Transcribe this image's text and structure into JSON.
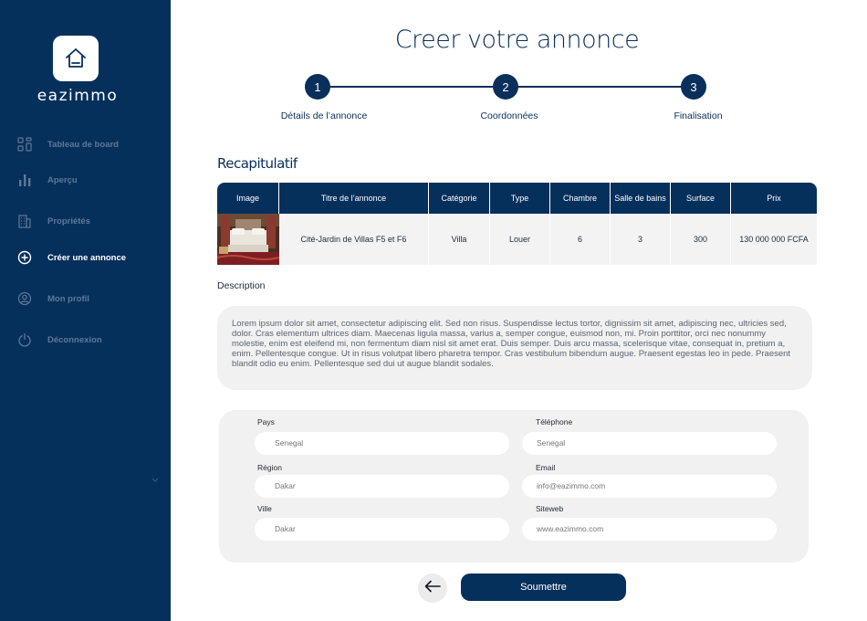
{
  "sidebar": {
    "logo_text": "eazimmo",
    "items": [
      {
        "label": "Tableau de board",
        "icon": "dashboard-icon"
      },
      {
        "label": "Aperçu",
        "icon": "bar-chart-icon"
      },
      {
        "label": "Propriétés",
        "icon": "building-icon"
      },
      {
        "label": "Créer une annonce",
        "icon": "plus-circle-icon"
      },
      {
        "label": "Mon profil",
        "icon": "user-circle-icon"
      },
      {
        "label": "Déconnexion",
        "icon": "power-icon"
      }
    ],
    "active_index": 3,
    "colors": {
      "background": "#06305c",
      "inactive_text": "#5f7896",
      "active_text": "#ffffff"
    }
  },
  "header": {
    "title": "Creer votre  annonce"
  },
  "stepper": {
    "steps": [
      {
        "number": "1",
        "label": "Détails de l’annonce"
      },
      {
        "number": "2",
        "label": "Coordonnées"
      },
      {
        "number": "3",
        "label": "Finalisation"
      }
    ]
  },
  "recap": {
    "title": "Recapitulatif",
    "columns": [
      "Image",
      "Titre de l’annonce",
      "Catégorie",
      "Type",
      "Chambre",
      "Salle de bains",
      "Surface",
      "Prix"
    ],
    "row": {
      "image": "bedroom-photo",
      "title": "Cité-Jardin de Villas F5 et F6",
      "category": "Villa",
      "type": "Louer",
      "rooms": "6",
      "bathrooms": "3",
      "surface": "300",
      "price": "130 000 000 FCFA"
    }
  },
  "description": {
    "label": "Description",
    "text": "Lorem ipsum dolor sit amet, consectetur adipiscing elit. Sed non risus. Suspendisse lectus tortor, dignissim sit amet, adipiscing nec, ultricies sed, dolor. Cras elementum ultrices diam. Maecenas ligula massa, varius a, semper congue, euismod non, mi. Proin porttitor, orci nec nonummy molestie, enim est eleifend mi, non fermentum diam nisl sit amet erat. Duis semper. Duis arcu massa, scelerisque vitae, consequat in, pretium a, enim. Pellentesque congue. Ut in risus volutpat libero pharetra tempor. Cras vestibulum bibendum augue. Praesent egestas leo in pede. Praesent blandit odio eu enim. Pellentesque sed dui ut augue blandit sodales."
  },
  "contact": {
    "pays": {
      "label": "Pays",
      "placeholder": "Senegal"
    },
    "region": {
      "label": "Région",
      "placeholder": "Dakar"
    },
    "ville": {
      "label": "Ville",
      "placeholder": "Dakar"
    },
    "telephone": {
      "label": "Téléphone",
      "placeholder": "Senegal"
    },
    "email": {
      "label": "Email",
      "placeholder": "info@eazimmo.com"
    },
    "siteweb": {
      "label": "Siteweb",
      "placeholder": "www.eazimmo.com"
    }
  },
  "actions": {
    "back_icon": "arrow-left-icon",
    "submit_label": "Soumettre"
  },
  "colors": {
    "primary": "#06305c",
    "panel": "#f1f1f1"
  }
}
